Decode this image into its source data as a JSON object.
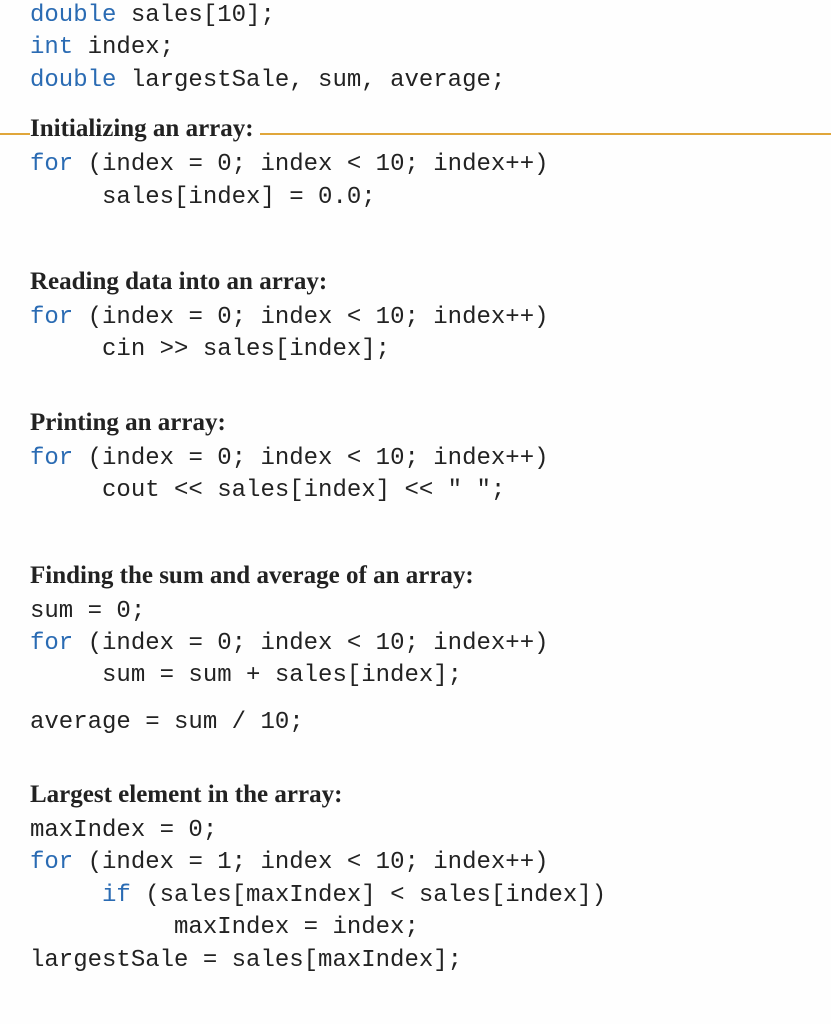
{
  "decl": {
    "kw1": "double",
    "line1_rest": " sales[10];",
    "kw2": "int",
    "line2_rest": " index;",
    "kw3": "double",
    "line3_rest": " largestSale, sum, average;"
  },
  "sections": {
    "init": {
      "heading": "Initializing an array:",
      "kw": "for",
      "line1": " (index = 0; index < 10; index++)",
      "line2": "     sales[index] = 0.0;"
    },
    "read": {
      "heading": "Reading data into an array:",
      "kw": "for",
      "line1": " (index = 0; index < 10; index++)",
      "line2": "     cin >> sales[index];"
    },
    "print": {
      "heading": "Printing an array:",
      "kw": "for",
      "line1": " (index = 0; index < 10; index++)",
      "line2": "     cout << sales[index] << \" \";"
    },
    "sumavg": {
      "heading": "Finding the sum and average of an array:",
      "line0": "sum = 0;",
      "kw": "for",
      "line1": " (index = 0; index < 10; index++)",
      "line2": "     sum = sum + sales[index];",
      "line3": "average = sum / 10;"
    },
    "largest": {
      "heading": "Largest element in the array:",
      "line0": "maxIndex = 0;",
      "kw1": "for",
      "line1": " (index = 1; index < 10; index++)",
      "kw2": "if",
      "line2a": "     ",
      "line2b": " (sales[maxIndex] < sales[index])",
      "line3": "          maxIndex = index;",
      "line4": "largestSale = sales[maxIndex];"
    }
  }
}
